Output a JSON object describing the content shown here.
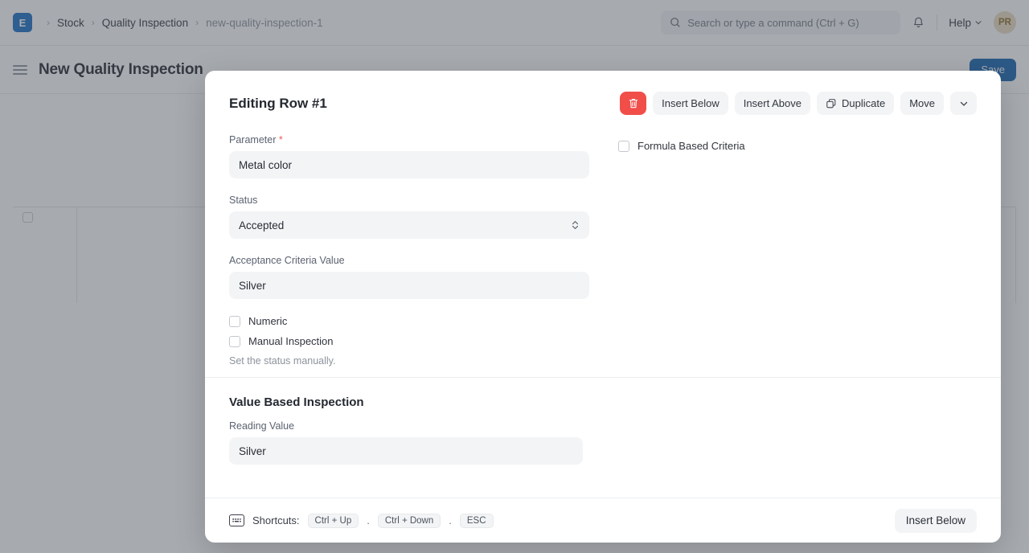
{
  "navbar": {
    "logo_text": "E",
    "breadcrumbs": [
      {
        "label": "Stock",
        "muted": false
      },
      {
        "label": "Quality Inspection",
        "muted": false
      },
      {
        "label": "new-quality-inspection-1",
        "muted": true
      }
    ],
    "separator": "›",
    "search_placeholder": "Search or type a command (Ctrl + G)",
    "help_label": "Help",
    "avatar_initials": "PR"
  },
  "page": {
    "title": "New Quality Inspection",
    "primary_button": "Save"
  },
  "modal": {
    "title": "Editing Row #1",
    "toolbar": {
      "delete_label": "",
      "insert_below": "Insert Below",
      "insert_above": "Insert Above",
      "duplicate": "Duplicate",
      "move": "Move"
    },
    "fields": {
      "parameter": {
        "label": "Parameter",
        "required": "*",
        "value": "Metal color"
      },
      "status": {
        "label": "Status",
        "value": "Accepted"
      },
      "acceptance_criteria_value": {
        "label": "Acceptance Criteria Value",
        "value": "Silver"
      }
    },
    "checkboxes": {
      "numeric": {
        "label": "Numeric",
        "checked": false
      },
      "manual_inspection": {
        "label": "Manual Inspection",
        "checked": false
      },
      "formula_based_criteria": {
        "label": "Formula Based Criteria",
        "checked": false
      }
    },
    "hint": "Set the status manually.",
    "section": {
      "title": "Value Based Inspection",
      "reading_value": {
        "label": "Reading Value",
        "value": "Silver"
      }
    },
    "footer": {
      "shortcuts_label": "Shortcuts:",
      "keys": [
        "Ctrl + Up",
        "Ctrl + Down",
        "ESC"
      ],
      "separator": ".",
      "action": "Insert Below"
    }
  },
  "colors": {
    "accent": "#1565b0",
    "danger": "#f14e4a",
    "field_bg": "#f3f4f6"
  }
}
